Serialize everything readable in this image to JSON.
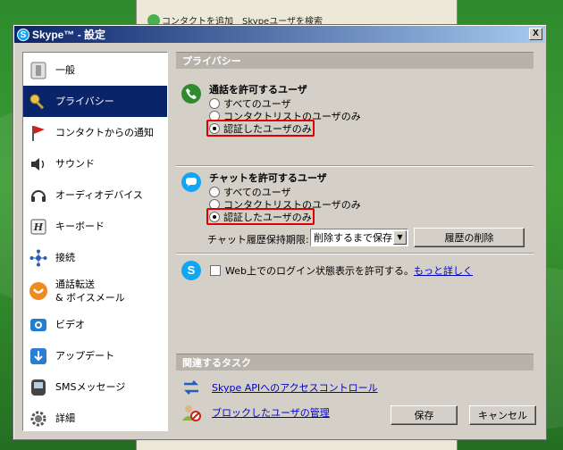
{
  "background_window": {
    "toolbar": [
      {
        "label": "コンタクトを追加",
        "icon": "add-contact-icon"
      },
      {
        "label": "Skypeユーザを検索",
        "icon": "search-user-icon"
      }
    ]
  },
  "dialog": {
    "title": "Skype™ - 設定",
    "close_label": "X"
  },
  "sidebar": {
    "items": [
      {
        "label": "一般",
        "icon": "switch-icon",
        "selected": false
      },
      {
        "label": "プライバシー",
        "icon": "key-icon",
        "selected": true
      },
      {
        "label": "コンタクトからの通知",
        "icon": "flag-icon",
        "selected": false
      },
      {
        "label": "サウンド",
        "icon": "speaker-icon",
        "selected": false
      },
      {
        "label": "オーディオデバイス",
        "icon": "headset-icon",
        "selected": false
      },
      {
        "label": "キーボード",
        "icon": "keyboard-h-icon",
        "selected": false
      },
      {
        "label": "接続",
        "icon": "network-icon",
        "selected": false
      },
      {
        "label": "通話転送\n& ボイスメール",
        "icon": "voicemail-icon",
        "selected": false
      },
      {
        "label": "ビデオ",
        "icon": "camera-icon",
        "selected": false
      },
      {
        "label": "アップデート",
        "icon": "update-icon",
        "selected": false
      },
      {
        "label": "SMSメッセージ",
        "icon": "sms-icon",
        "selected": false
      },
      {
        "label": "詳細",
        "icon": "gear-icon",
        "selected": false
      }
    ]
  },
  "privacy": {
    "header": "プライバシー",
    "calls": {
      "title": "通話を許可するユーザ",
      "options": [
        "すべてのユーザ",
        "コンタクトリストのユーザのみ",
        "認証したユーザのみ"
      ],
      "selected_index": 2
    },
    "chat": {
      "title": "チャットを許可するユーザ",
      "options": [
        "すべてのユーザ",
        "コンタクトリストのユーザのみ",
        "認証したユーザのみ"
      ],
      "selected_index": 2,
      "history_label": "チャット履歴保持期限:",
      "history_value": "削除するまで保存",
      "clear_history_button": "履歴の削除"
    },
    "web_status": {
      "label": "Web上でのログイン状態表示を許可する。",
      "checked": false,
      "more_link": "もっと詳しく"
    }
  },
  "related_tasks": {
    "header": "関連するタスク",
    "items": [
      {
        "label": "Skype APIへのアクセスコントロール",
        "icon": "api-arrows-icon"
      },
      {
        "label": "ブロックしたユーザの管理",
        "icon": "blocked-user-icon"
      }
    ]
  },
  "footer": {
    "save_button": "保存",
    "cancel_button": "キャンセル"
  },
  "colors": {
    "selected_nav_bg": "#0a246a",
    "highlight_border": "#e00000",
    "link": "#0000cc",
    "skype_blue": "#12a5f4"
  }
}
